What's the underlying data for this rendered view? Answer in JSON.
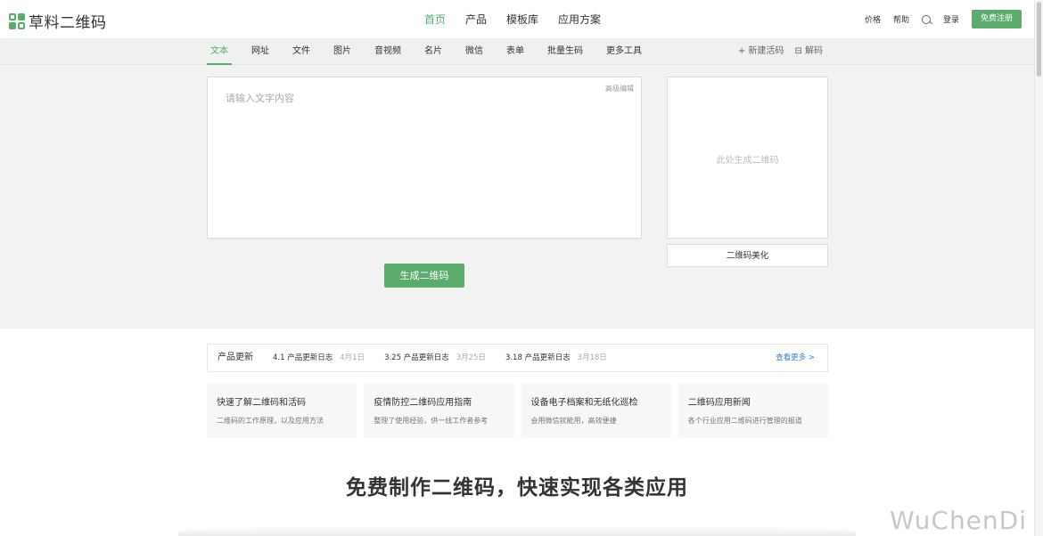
{
  "header": {
    "logo_text": "草料二维码",
    "nav": [
      "首页",
      "产品",
      "模板库",
      "应用方案"
    ],
    "price": "价格",
    "help": "帮助",
    "login": "登录",
    "register": "免费注册"
  },
  "subnav": {
    "tabs": [
      "文本",
      "网址",
      "文件",
      "图片",
      "音视频",
      "名片",
      "微信",
      "表单",
      "批量生码",
      "更多工具"
    ],
    "new_live_code": "+ 新建活码",
    "decode": "⊟ 解码"
  },
  "editor": {
    "placeholder": "请输入文字内容",
    "advanced_edit": "高级编辑"
  },
  "generate_button": "生成二维码",
  "qr_preview": {
    "placeholder": "此处生成二维码",
    "beautify": "二维码美化"
  },
  "updates": {
    "label": "产品更新",
    "items": [
      {
        "title": "4.1 产品更新日志",
        "date": "4月1日"
      },
      {
        "title": "3.25 产品更新日志",
        "date": "3月25日"
      },
      {
        "title": "3.18 产品更新日志",
        "date": "3月18日"
      }
    ],
    "more": "查看更多 >"
  },
  "cards": [
    {
      "title": "快速了解二维码和活码",
      "desc": "二维码的工作原理，以及应用方法"
    },
    {
      "title": "疫情防控二维码应用指南",
      "desc": "整理了使用经验，供一线工作者参考"
    },
    {
      "title": "设备电子档案和无纸化巡检",
      "desc": "会用微信就能用，高效便捷"
    },
    {
      "title": "二维码应用新闻",
      "desc": "各个行业应用二维码进行管理的报道"
    }
  ],
  "headline": "免费制作二维码，快速实现各类应用",
  "watermark": "WuChenDi",
  "colors": {
    "accent": "#5aab6c"
  }
}
